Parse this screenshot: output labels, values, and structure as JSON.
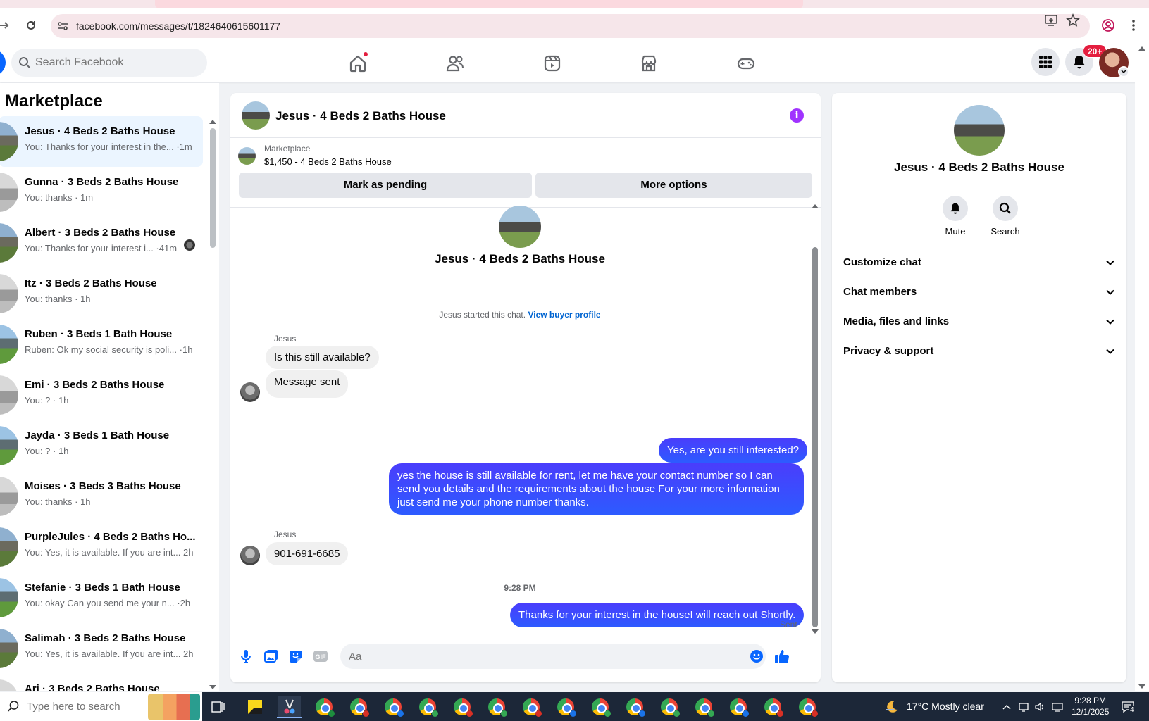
{
  "browser": {
    "url": "facebook.com/messages/t/1824640615601177"
  },
  "header": {
    "search_placeholder": "Search Facebook",
    "notification_count": "20+"
  },
  "sidebar": {
    "title": "Marketplace",
    "conversations": [
      {
        "title": "Jesus · 4 Beds 2 Baths House",
        "snippet": "You: Thanks for your interest in the... ·1m",
        "active": true
      },
      {
        "title": "Gunna · 3 Beds 2 Baths House",
        "snippet": "You: thanks · 1m"
      },
      {
        "title": "Albert · 3 Beds 2 Baths House",
        "snippet": "You: Thanks for your interest i...  ·41m"
      },
      {
        "title": "Itz · 3 Beds 2 Baths House",
        "snippet": "You: thanks · 1h"
      },
      {
        "title": "Ruben · 3 Beds 1 Bath House",
        "snippet": "Ruben: Ok my social security is poli... ·1h"
      },
      {
        "title": "Emi · 3 Beds 2 Baths House",
        "snippet": "You: ? · 1h"
      },
      {
        "title": "Jayda · 3 Beds 1 Bath House",
        "snippet": "You: ? · 1h"
      },
      {
        "title": "Moises · 3 Beds 3 Baths House",
        "snippet": "You: thanks · 1h"
      },
      {
        "title": "PurpleJules · 4 Beds 2 Baths Ho...",
        "snippet": "You: Yes, it is available. If you are int... 2h"
      },
      {
        "title": "Stefanie · 3 Beds 1 Bath House",
        "snippet": "You: okay Can you send me your n...  ·2h"
      },
      {
        "title": "Salimah · 3 Beds 2 Baths House",
        "snippet": "You: Yes, it is available. If you are int... 2h"
      },
      {
        "title": "Ari · 3 Beds 2 Baths House",
        "snippet": ""
      }
    ]
  },
  "conversation": {
    "title": "Jesus · 4 Beds 2 Baths House",
    "listing_source": "Marketplace",
    "listing_price": "$1,450 - 4 Beds 2 Baths House",
    "mark_pending_label": "Mark as pending",
    "more_options_label": "More options",
    "started_text": "Jesus started this chat.",
    "view_profile_label": "View buyer profile",
    "sender1": "Jesus",
    "msg1": "Is this still available?",
    "msg2": "Message sent",
    "msg3": "Yes, are you still interested?",
    "msg4": "yes the house is still available for rent, let me have your contact number so I can send you details and the requirements about the house For  your  more  information  just send  me   your  phone  number thanks.",
    "sender2": "Jesus",
    "msg5": "901-691-6685",
    "timestamp": "9:28 PM",
    "msg6": "Thanks for your interest in the houseI will reach out Shortly.",
    "sent_label": "Sent",
    "composer_placeholder": "Aa"
  },
  "details": {
    "name": "Jesus · 4 Beds 2 Baths House",
    "mute_label": "Mute",
    "search_label": "Search",
    "sections": [
      "Customize chat",
      "Chat members",
      "Media, files and links",
      "Privacy & support"
    ]
  },
  "taskbar": {
    "search_placeholder": "Type here to search",
    "weather": "17°C  Mostly clear",
    "time": "9:28 PM",
    "date": "12/1/2025",
    "notification_count": "4"
  },
  "colors": {
    "accent": "#0866ff",
    "outgoing_bubble": "#3b3fff",
    "info_icon": "#a033ff",
    "badge_red": "#e41e3f"
  }
}
